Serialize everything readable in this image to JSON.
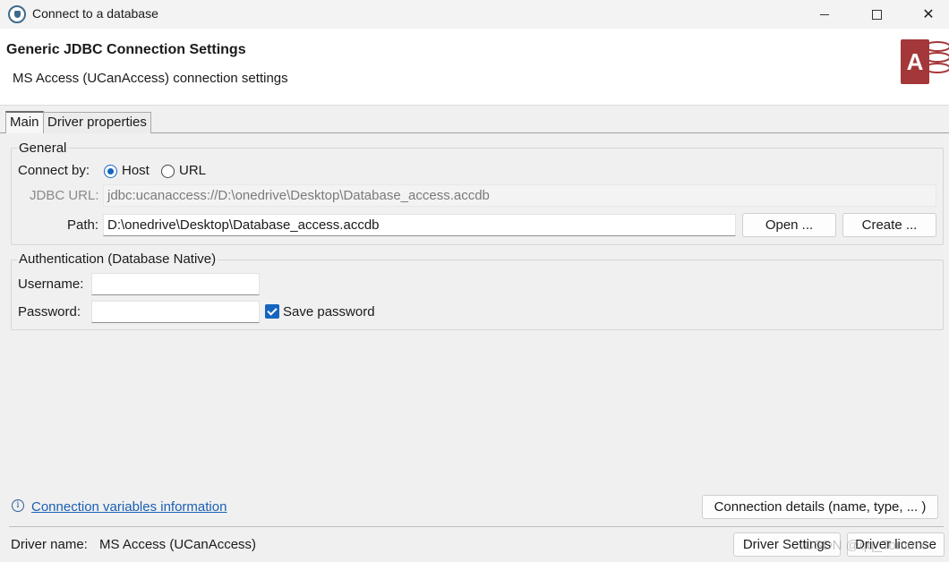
{
  "window": {
    "title": "Connect to a database",
    "minimize_icon": "minimize-icon",
    "maximize_icon": "maximize-icon",
    "close_glyph": "✕"
  },
  "header": {
    "title": "Generic JDBC Connection Settings",
    "subtitle": "MS Access (UCanAccess) connection settings",
    "logo_letter": "A",
    "logo_color": "#a4373a"
  },
  "tabs": [
    {
      "label": "Main",
      "active": true
    },
    {
      "label": "Driver properties",
      "active": false
    }
  ],
  "general": {
    "group_label": "General",
    "connect_by_label": "Connect by:",
    "option_host": "Host",
    "option_url": "URL",
    "selected": "Host",
    "jdbc_url_label": "JDBC URL:",
    "jdbc_url_value": "jdbc:ucanaccess://D:\\onedrive\\Desktop\\Database_access.accdb",
    "path_label": "Path:",
    "path_value": "D:\\onedrive\\Desktop\\Database_access.accdb",
    "open_button": "Open ...",
    "create_button": "Create ..."
  },
  "auth": {
    "group_label": "Authentication (Database Native)",
    "username_label": "Username:",
    "username_value": "",
    "password_label": "Password:",
    "password_value": "",
    "save_password_label": "Save password",
    "save_password_checked": true
  },
  "footer": {
    "info_link": "Connection variables information",
    "connection_details_button": "Connection details (name, type, ... )",
    "driver_name_label": "Driver name:",
    "driver_name_value": "MS Access (UCanAccess)",
    "driver_settings_button": "Driver Settings",
    "driver_license_button": "Driver license",
    "watermark": "CSDN @qq_Tommx"
  },
  "colors": {
    "accent": "#1565c0",
    "link": "#1a5fb4"
  }
}
